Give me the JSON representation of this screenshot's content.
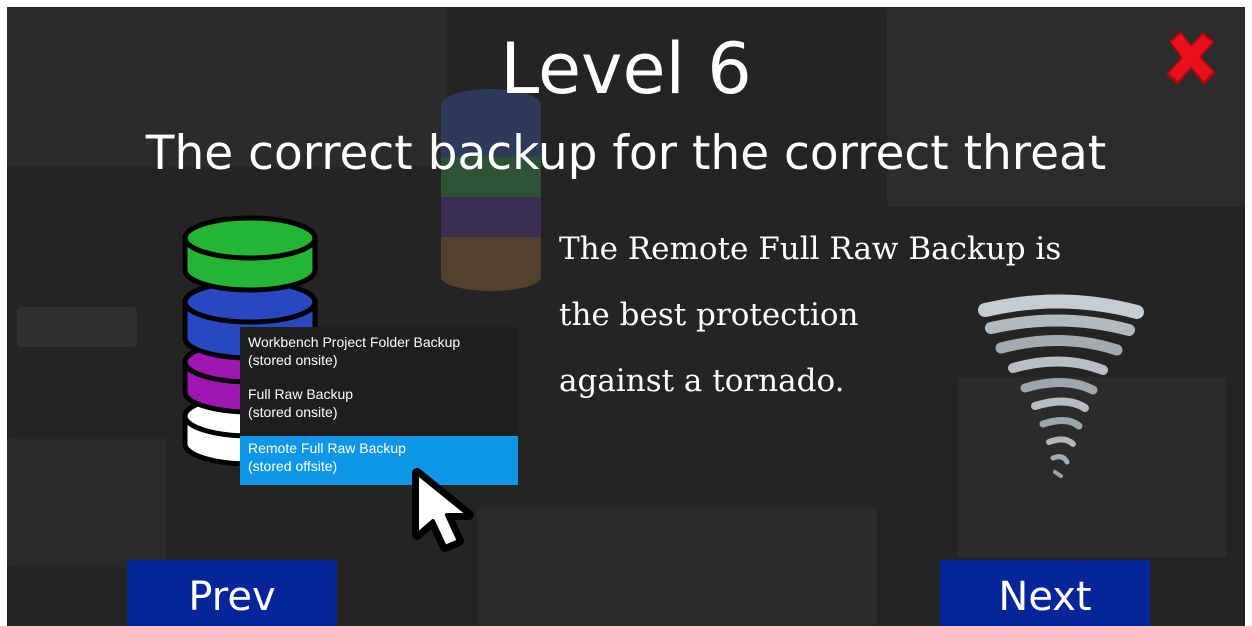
{
  "header": {
    "title": "Level 6",
    "subtitle": "The correct backup for the correct threat"
  },
  "close": {
    "icon": "close-x-icon",
    "color": "#e8101a"
  },
  "message": {
    "lines": [
      "The Remote Full Raw Backup is",
      "the best protection",
      "against a tornado."
    ]
  },
  "backup_menu": {
    "items": [
      {
        "line1": "Workbench Project Folder Backup",
        "line2": "(stored onsite)",
        "selected": false
      },
      {
        "line1": "Full Raw Backup",
        "line2": "(stored onsite)",
        "selected": false
      },
      {
        "line1": "Remote Full Raw Backup",
        "line2": "(stored offsite)",
        "selected": true
      }
    ],
    "selected_color": "#0e96e8"
  },
  "icons": {
    "stack": "database-stack-icon",
    "cursor": "mouse-pointer-icon",
    "tornado": "tornado-icon"
  },
  "colors": {
    "green": "#23b533",
    "blue": "#2a47c2",
    "purple": "#a016b0",
    "white": "#ffffff",
    "nav": "#07259b"
  },
  "nav": {
    "prev_label": "Prev",
    "next_label": "Next"
  }
}
